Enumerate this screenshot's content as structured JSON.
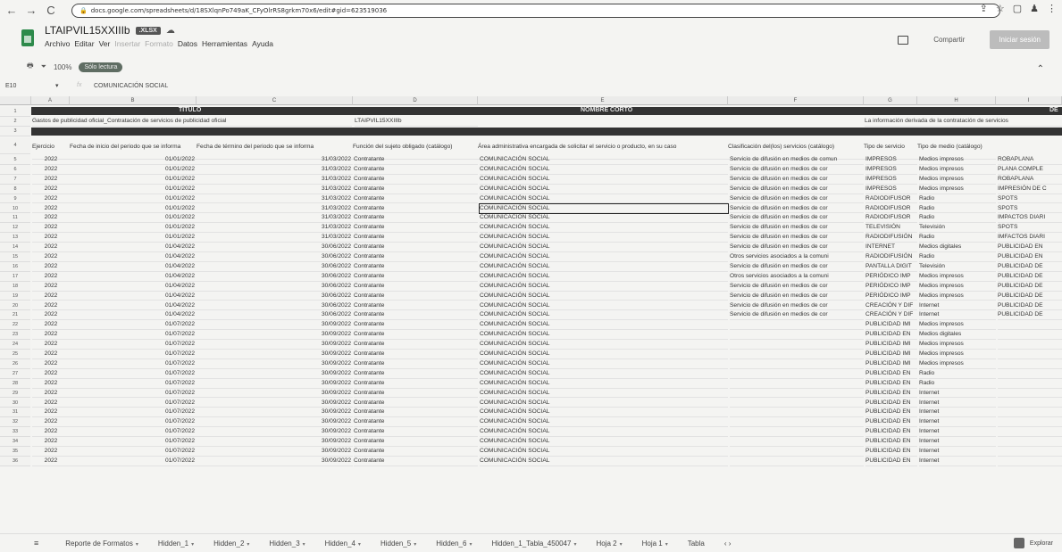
{
  "browser": {
    "url": "docs.google.com/spreadsheets/d/18SXlqnPo749aK_CFyOlrRS8grkm70x6/edit#gid=623519036",
    "back_icon": "←",
    "forward_icon": "→",
    "reload_icon": "C",
    "share_icon": "⇪",
    "star_icon": "☆",
    "ext_icon": "▢",
    "profile_icon": "♟",
    "more_icon": "⋮"
  },
  "doc": {
    "title": "LTAIPVIL15XXIIIb",
    "badge": ".XLSX",
    "menu": [
      "Archivo",
      "Editar",
      "Ver",
      "Insertar",
      "Formato",
      "Datos",
      "Herramientas",
      "Ayuda"
    ],
    "share_label": "Compartir",
    "signin_label": "Iniciar sesión"
  },
  "toolbar": {
    "zoom": "100%",
    "readonly": "Sólo lectura"
  },
  "formula": {
    "cell_ref": "E10",
    "value": "COMUNICACIÓN SOCIAL"
  },
  "columns": [
    "A",
    "B",
    "C",
    "D",
    "E",
    "F",
    "G",
    "H",
    "I"
  ],
  "header_rows": {
    "r1": {
      "titulo": "TITULO",
      "nombre": "NOMBRE CORTO",
      "desc": "DE"
    },
    "r2": {
      "a": "Gastos de publicidad oficial_Contratación de servicios de publicidad oficial",
      "d": "LTAIPVIL15XXIIIb",
      "g": "La información derivada de la contratación de servicios"
    },
    "r4": {
      "a": "Ejercicio",
      "b": "Fecha de inicio del periodo que se informa",
      "c": "Fecha de término del periodo que se informa",
      "d": "Función del sujeto obligado (catálogo)",
      "e": "Área administrativa encargada de solicitar el servicio o producto, en su caso",
      "f": "Clasificación del(los) servicios (catálogo)",
      "g": "Tipo de servicio",
      "h": "Tipo de medio (catálogo)"
    }
  },
  "rows": [
    {
      "n": "5",
      "a": "2022",
      "b": "01/01/2022",
      "c": "31/03/2022",
      "d": "Contratante",
      "e": "COMUNICACIÓN SOCIAL",
      "f": "Servicio de difusión en medios de comun",
      "g": "IMPRESOS",
      "h": "Medios impresos",
      "i": "ROBAPLANA"
    },
    {
      "n": "6",
      "a": "2022",
      "b": "01/01/2022",
      "c": "31/03/2022",
      "d": "Contratante",
      "e": "COMUNICACIÓN SOCIAL",
      "f": "Servicio de difusión en medios de cor",
      "g": "IMPRESOS",
      "h": "Medios impresos",
      "i": "PLANA COMPLE"
    },
    {
      "n": "7",
      "a": "2022",
      "b": "01/01/2022",
      "c": "31/03/2022",
      "d": "Contratante",
      "e": "COMUNICACIÓN SOCIAL",
      "f": "Servicio de difusión en medios de cor",
      "g": "IMPRESOS",
      "h": "Medios impresos",
      "i": "ROBAPLANA"
    },
    {
      "n": "8",
      "a": "2022",
      "b": "01/01/2022",
      "c": "31/03/2022",
      "d": "Contratante",
      "e": "COMUNICACIÓN SOCIAL",
      "f": "Servicio de difusión en medios de cor",
      "g": "IMPRESOS",
      "h": "Medios impresos",
      "i": "IMPRESIÓN DE C"
    },
    {
      "n": "9",
      "a": "2022",
      "b": "01/01/2022",
      "c": "31/03/2022",
      "d": "Contratante",
      "e": "COMUNICACIÓN SOCIAL",
      "f": "Servicio de difusión en medios de cor",
      "g": "RADIODIFUSOR",
      "h": "Radio",
      "i": "SPOTS"
    },
    {
      "n": "10",
      "a": "2022",
      "b": "01/01/2022",
      "c": "31/03/2022",
      "d": "Contratante",
      "e": "COMUNICACIÓN SOCIAL",
      "f": "Servicio de difusión en medios de cor",
      "g": "RADIODIFUSOR",
      "h": "Radio",
      "i": "SPOTS"
    },
    {
      "n": "11",
      "a": "2022",
      "b": "01/01/2022",
      "c": "31/03/2022",
      "d": "Contratante",
      "e": "COMUNICACIÓN SOCIAL",
      "f": "Servicio de difusión en medios de cor",
      "g": "RADIODIFUSOR",
      "h": "Radio",
      "i": "IMPACTOS DIARI"
    },
    {
      "n": "12",
      "a": "2022",
      "b": "01/01/2022",
      "c": "31/03/2022",
      "d": "Contratante",
      "e": "COMUNICACIÓN SOCIAL",
      "f": "Servicio de difusión en medios de cor",
      "g": "TELEVISIÓN",
      "h": "Televisión",
      "i": "SPOTS"
    },
    {
      "n": "13",
      "a": "2022",
      "b": "01/01/2022",
      "c": "31/03/2022",
      "d": "Contratante",
      "e": "COMUNICACIÓN SOCIAL",
      "f": "Servicio de difusión en medios de cor",
      "g": "RADIODIFUSIÓN",
      "h": "Radio",
      "i": "IMFACTOS DIARI"
    },
    {
      "n": "14",
      "a": "2022",
      "b": "01/04/2022",
      "c": "30/06/2022",
      "d": "Contratante",
      "e": "COMUNICACIÓN SOCIAL",
      "f": "Servicio de difusión en medios de cor",
      "g": "INTERNET",
      "h": "Medios digitales",
      "i": "PUBLICIDAD EN"
    },
    {
      "n": "15",
      "a": "2022",
      "b": "01/04/2022",
      "c": "30/06/2022",
      "d": "Contratante",
      "e": "COMUNICACIÓN SOCIAL",
      "f": "Otros servicios asociados a la comuni",
      "g": "RADIODIFUSIÓN",
      "h": "Radio",
      "i": "PUBLICIDAD EN"
    },
    {
      "n": "16",
      "a": "2022",
      "b": "01/04/2022",
      "c": "30/06/2022",
      "d": "Contratante",
      "e": "COMUNICACIÓN SOCIAL",
      "f": "Servicio de difusión en medios de cor",
      "g": "PANTALLA DIGIT",
      "h": "Televisión",
      "i": "PUBLICIDAD DE"
    },
    {
      "n": "17",
      "a": "2022",
      "b": "01/04/2022",
      "c": "30/06/2022",
      "d": "Contratante",
      "e": "COMUNICACIÓN SOCIAL",
      "f": "Otros servicios asociados a la comuni",
      "g": "PERIÓDICO IMP",
      "h": "Medios impresos",
      "i": "PUBLICIDAD DE"
    },
    {
      "n": "18",
      "a": "2022",
      "b": "01/04/2022",
      "c": "30/06/2022",
      "d": "Contratante",
      "e": "COMUNICACIÓN SOCIAL",
      "f": "Servicio de difusión en medios de cor",
      "g": "PERIÓDICO IMP",
      "h": "Medios impresos",
      "i": "PUBLICIDAD DE"
    },
    {
      "n": "19",
      "a": "2022",
      "b": "01/04/2022",
      "c": "30/06/2022",
      "d": "Contratante",
      "e": "COMUNICACIÓN SOCIAL",
      "f": "Servicio de difusión en medios de cor",
      "g": "PERIÓDICO IMP",
      "h": "Medios impresos",
      "i": "PUBLICIDAD DE"
    },
    {
      "n": "20",
      "a": "2022",
      "b": "01/04/2022",
      "c": "30/06/2022",
      "d": "Contratante",
      "e": "COMUNICACIÓN SOCIAL",
      "f": "Servicio de difusión en medios de cor",
      "g": "CREACIÓN Y DIF",
      "h": "Internet",
      "i": "PUBLICIDAD DE"
    },
    {
      "n": "21",
      "a": "2022",
      "b": "01/04/2022",
      "c": "30/06/2022",
      "d": "Contratante",
      "e": "COMUNICACIÓN SOCIAL",
      "f": "Servicio de difusión en medios de cor",
      "g": "CREACIÓN Y DIF",
      "h": "Internet",
      "i": "PUBLICIDAD DE"
    },
    {
      "n": "22",
      "a": "2022",
      "b": "01/07/2022",
      "c": "30/09/2022",
      "d": "Contratante",
      "e": "COMUNICACIÓN SOCIAL",
      "f": "",
      "g": "PUBLICIDAD IMI",
      "h": "Medios impresos",
      "i": ""
    },
    {
      "n": "23",
      "a": "2022",
      "b": "01/07/2022",
      "c": "30/09/2022",
      "d": "Contratante",
      "e": "COMUNICACIÓN SOCIAL",
      "f": "",
      "g": "PUBLICIDAD EN",
      "h": "Medios digitales",
      "i": ""
    },
    {
      "n": "24",
      "a": "2022",
      "b": "01/07/2022",
      "c": "30/09/2022",
      "d": "Contratante",
      "e": "COMUNICACIÓN SOCIAL",
      "f": "",
      "g": "PUBLICIDAD IMI",
      "h": "Medios impresos",
      "i": ""
    },
    {
      "n": "25",
      "a": "2022",
      "b": "01/07/2022",
      "c": "30/09/2022",
      "d": "Contratante",
      "e": "COMUNICACIÓN SOCIAL",
      "f": "",
      "g": "PUBLICIDAD IMI",
      "h": "Medios impresos",
      "i": ""
    },
    {
      "n": "26",
      "a": "2022",
      "b": "01/07/2022",
      "c": "30/09/2022",
      "d": "Contratante",
      "e": "COMUNICACIÓN SOCIAL",
      "f": "",
      "g": "PUBLICIDAD IMI",
      "h": "Medios impresos",
      "i": ""
    },
    {
      "n": "27",
      "a": "2022",
      "b": "01/07/2022",
      "c": "30/09/2022",
      "d": "Contratante",
      "e": "COMUNICACIÓN SOCIAL",
      "f": "",
      "g": "PUBLICIDAD EN",
      "h": "Radio",
      "i": ""
    },
    {
      "n": "28",
      "a": "2022",
      "b": "01/07/2022",
      "c": "30/09/2022",
      "d": "Contratante",
      "e": "COMUNICACIÓN SOCIAL",
      "f": "",
      "g": "PUBLICIDAD EN",
      "h": "Radio",
      "i": ""
    },
    {
      "n": "29",
      "a": "2022",
      "b": "01/07/2022",
      "c": "30/09/2022",
      "d": "Contratante",
      "e": "COMUNICACIÓN SOCIAL",
      "f": "",
      "g": "PUBLICIDAD EN",
      "h": "Internet",
      "i": ""
    },
    {
      "n": "30",
      "a": "2022",
      "b": "01/07/2022",
      "c": "30/09/2022",
      "d": "Contratante",
      "e": "COMUNICACIÓN SOCIAL",
      "f": "",
      "g": "PUBLICIDAD EN",
      "h": "Internet",
      "i": ""
    },
    {
      "n": "31",
      "a": "2022",
      "b": "01/07/2022",
      "c": "30/09/2022",
      "d": "Contratante",
      "e": "COMUNICACIÓN SOCIAL",
      "f": "",
      "g": "PUBLICIDAD EN",
      "h": "Internet",
      "i": ""
    },
    {
      "n": "32",
      "a": "2022",
      "b": "01/07/2022",
      "c": "30/09/2022",
      "d": "Contratante",
      "e": "COMUNICACIÓN SOCIAL",
      "f": "",
      "g": "PUBLICIDAD EN",
      "h": "Internet",
      "i": ""
    },
    {
      "n": "33",
      "a": "2022",
      "b": "01/07/2022",
      "c": "30/09/2022",
      "d": "Contratante",
      "e": "COMUNICACIÓN SOCIAL",
      "f": "",
      "g": "PUBLICIDAD EN",
      "h": "Internet",
      "i": ""
    },
    {
      "n": "34",
      "a": "2022",
      "b": "01/07/2022",
      "c": "30/09/2022",
      "d": "Contratante",
      "e": "COMUNICACIÓN SOCIAL",
      "f": "",
      "g": "PUBLICIDAD EN",
      "h": "Internet",
      "i": ""
    },
    {
      "n": "35",
      "a": "2022",
      "b": "01/07/2022",
      "c": "30/09/2022",
      "d": "Contratante",
      "e": "COMUNICACIÓN SOCIAL",
      "f": "",
      "g": "PUBLICIDAD EN",
      "h": "Internet",
      "i": ""
    },
    {
      "n": "36",
      "a": "2022",
      "b": "01/07/2022",
      "c": "30/09/2022",
      "d": "Contratante",
      "e": "COMUNICACIÓN SOCIAL",
      "f": "",
      "g": "PUBLICIDAD EN",
      "h": "Internet",
      "i": ""
    }
  ],
  "selected_row": "10",
  "sheet_tabs": [
    "Reporte de Formatos",
    "Hidden_1",
    "Hidden_2",
    "Hidden_3",
    "Hidden_4",
    "Hidden_5",
    "Hidden_6",
    "Hidden_1_Tabla_450047",
    "Hoja 2",
    "Hoja 1",
    "Tabla"
  ],
  "explore_label": "Explorar",
  "colors": {
    "header_bar": "#333333",
    "signin_bg": "#bcbcbc",
    "readonly_pill": "#5f6d63",
    "sheets_green": "#2d8a4b"
  }
}
